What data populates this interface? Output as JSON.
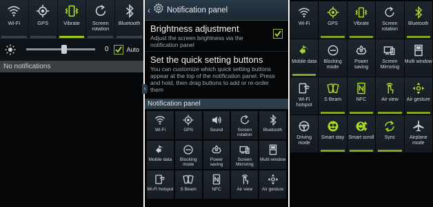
{
  "left_panel": {
    "quick_settings": [
      {
        "label": "Wi-Fi",
        "icon": "wifi-icon",
        "active": false
      },
      {
        "label": "GPS",
        "icon": "gps-icon",
        "active": false
      },
      {
        "label": "Vibrate",
        "icon": "vibrate-icon",
        "active": true
      },
      {
        "label": "Screen rotation",
        "icon": "rotation-icon",
        "active": false
      },
      {
        "label": "Bluetooth",
        "icon": "bluetooth-icon",
        "active": false
      }
    ],
    "brightness": {
      "value": "0",
      "level": 0.55,
      "auto_label": "Auto",
      "auto_checked": true
    },
    "no_notifications": "No notifications"
  },
  "middle_panel": {
    "header_title": "Notification panel",
    "brightness_title": "Brightness adjustment",
    "brightness_desc": "Adjust the screen brightness via the notification panel",
    "brightness_checked": true,
    "quick_title": "Set the quick setting buttons",
    "quick_desc": "You can customize which quick setting buttons appear at the top of the notification panel. Press and hold, then drag buttons to add or re-order them",
    "section_header": "Notification panel",
    "grid": [
      {
        "label": "Wi-Fi",
        "icon": "wifi-icon"
      },
      {
        "label": "GPS",
        "icon": "gps-icon"
      },
      {
        "label": "Sound",
        "icon": "sound-icon"
      },
      {
        "label": "Screen rotation",
        "icon": "rotation-icon"
      },
      {
        "label": "Bluetooth",
        "icon": "bluetooth-icon"
      },
      {
        "label": "Mobile data",
        "icon": "mobile-data-icon"
      },
      {
        "label": "Blocking mode",
        "icon": "blocking-mode-icon"
      },
      {
        "label": "Power saving",
        "icon": "power-saving-icon"
      },
      {
        "label": "Screen Mirroring",
        "icon": "screen-mirroring-icon"
      },
      {
        "label": "Multi window",
        "icon": "multi-window-icon"
      },
      {
        "label": "Wi-Fi hotspot",
        "icon": "wifi-hotspot-icon"
      },
      {
        "label": "S Beam",
        "icon": "s-beam-icon"
      },
      {
        "label": "NFC",
        "icon": "nfc-icon"
      },
      {
        "label": "Air view",
        "icon": "air-view-icon"
      },
      {
        "label": "Air gesture",
        "icon": "air-gesture-icon"
      }
    ]
  },
  "right_panel": {
    "grid": [
      {
        "label": "Wi-Fi",
        "icon": "wifi-icon",
        "active": false
      },
      {
        "label": "GPS",
        "icon": "gps-icon",
        "active": true
      },
      {
        "label": "Vibrate",
        "icon": "vibrate-icon",
        "active": true
      },
      {
        "label": "Screen rotation",
        "icon": "rotation-icon",
        "active": false
      },
      {
        "label": "Bluetooth",
        "icon": "bluetooth-icon",
        "active": true
      },
      {
        "label": "Mobile data",
        "icon": "mobile-data-icon",
        "active": true
      },
      {
        "label": "Blocking mode",
        "icon": "blocking-mode-icon",
        "active": false
      },
      {
        "label": "Power saving",
        "icon": "power-saving-icon",
        "active": false
      },
      {
        "label": "Screen Mirroring",
        "icon": "screen-mirroring-icon",
        "active": false
      },
      {
        "label": "Multi window",
        "icon": "multi-window-icon",
        "active": false
      },
      {
        "label": "Wi-Fi hotspot",
        "icon": "wifi-hotspot-icon",
        "active": false
      },
      {
        "label": "S Beam",
        "icon": "s-beam-icon",
        "active": true
      },
      {
        "label": "NFC",
        "icon": "nfc-icon",
        "active": true
      },
      {
        "label": "Air view",
        "icon": "air-view-icon",
        "active": true
      },
      {
        "label": "Air gesture",
        "icon": "air-gesture-icon",
        "active": true
      },
      {
        "label": "Driving mode",
        "icon": "driving-mode-icon",
        "active": false
      },
      {
        "label": "Smart stay",
        "icon": "smart-stay-icon",
        "active": true
      },
      {
        "label": "Smart scroll",
        "icon": "smart-scroll-icon",
        "active": true
      },
      {
        "label": "Sync",
        "icon": "sync-icon",
        "active": true
      },
      {
        "label": "Airplane mode",
        "icon": "airplane-mode-icon",
        "active": false
      }
    ]
  },
  "colors": {
    "accent": "#a8d92a",
    "panel_bg": "#050607",
    "header_bg": "#2c3e4c"
  }
}
